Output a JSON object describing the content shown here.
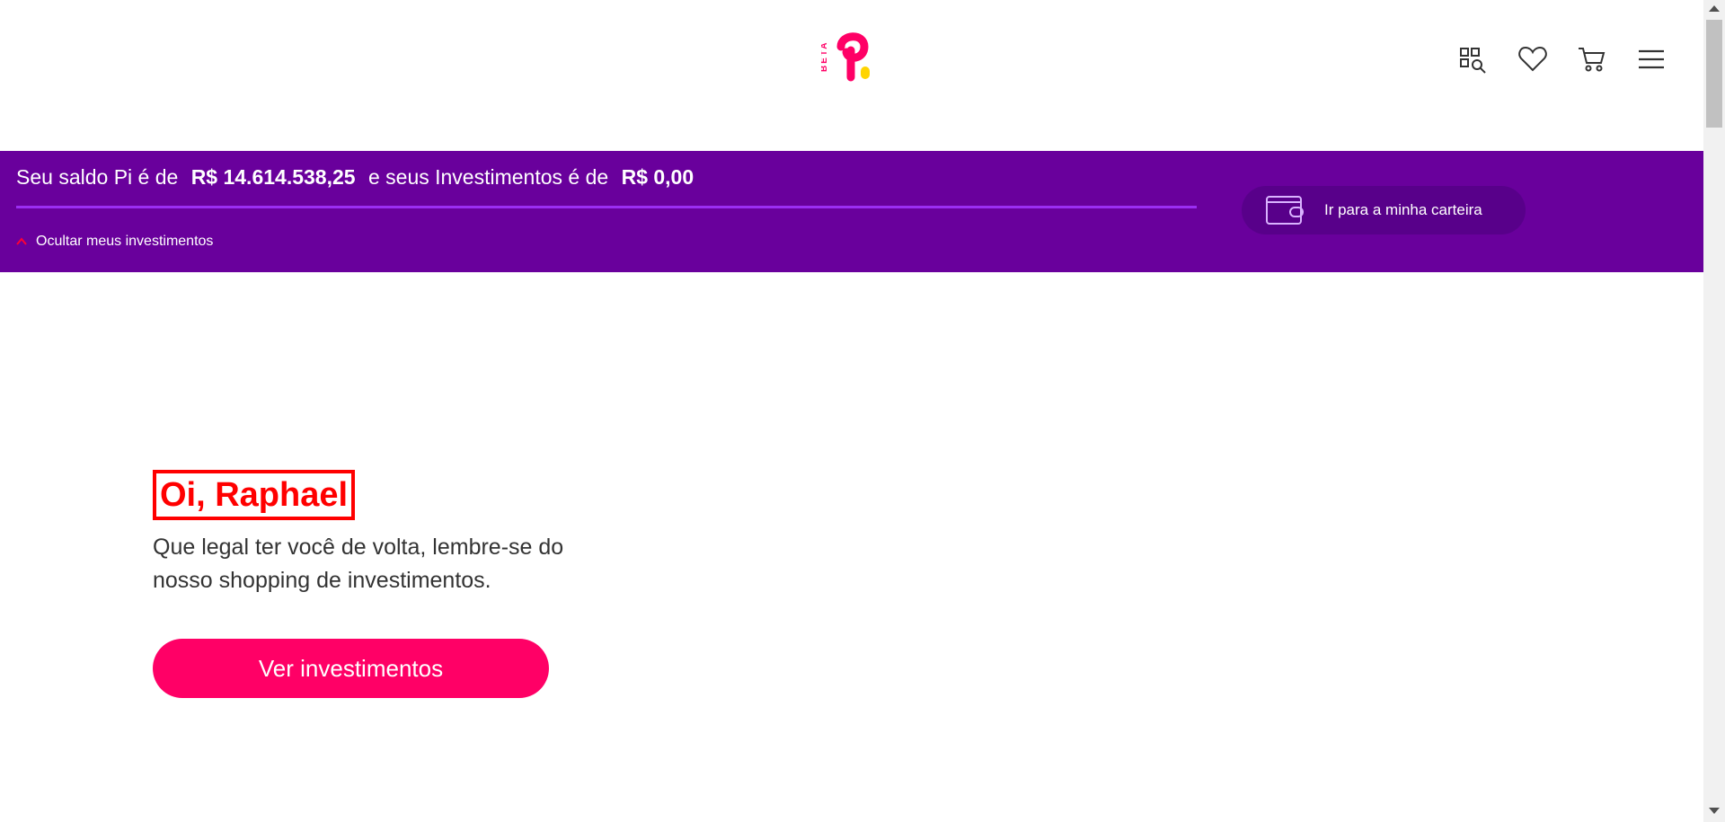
{
  "header": {
    "logo_badge": "BETA",
    "icons": [
      "category-search-icon",
      "heart-icon",
      "cart-icon",
      "menu-icon"
    ]
  },
  "balance": {
    "prefix": "Seu saldo Pi é de",
    "pi_amount": "R$ 14.614.538,25",
    "middle": "e seus Investimentos é de",
    "invest_amount": "R$ 0,00",
    "hide_label": "Ocultar meus investimentos",
    "wallet_label": "Ir para a minha carteira"
  },
  "main": {
    "greeting": "Oi, Raphael",
    "subtitle": "Que legal ter você de volta, lembre-se do nosso shopping de investimentos.",
    "cta_label": "Ver investimentos"
  },
  "colors": {
    "brand_purple": "#69009c",
    "brand_pink": "#ff0066",
    "accent_yellow": "#ffd400"
  }
}
